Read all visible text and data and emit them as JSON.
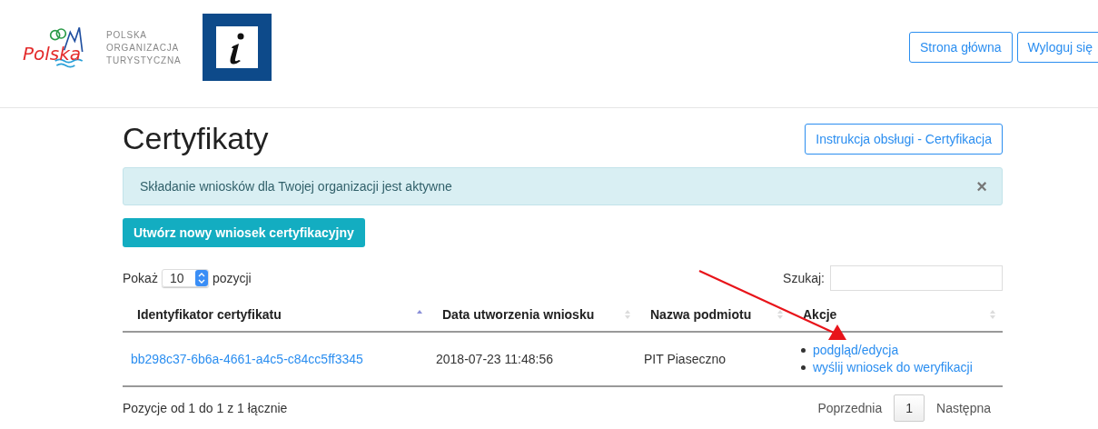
{
  "header": {
    "logo_text": "Polska",
    "org_lines": [
      "POLSKA",
      "ORGANIZACJA",
      "TURYSTYCZNA"
    ],
    "buttons": [
      "Strona główna",
      "Wyloguj się"
    ]
  },
  "page": {
    "title": "Certyfikaty",
    "manual_button": "Instrukcja obsługi - Certyfikacja"
  },
  "alert": {
    "text": "Składanie wniosków dla Twojej organizacji jest aktywne",
    "close": "×"
  },
  "create_button": "Utwórz nowy wniosek certyfikacyjny",
  "length": {
    "label_before": "Pokaż",
    "value": "10",
    "label_after": "pozycji"
  },
  "search": {
    "label": "Szukaj:"
  },
  "table": {
    "columns": [
      {
        "label": "Identyfikator certyfikatu",
        "sorted": true
      },
      {
        "label": "Data utworzenia wniosku",
        "sorted": false
      },
      {
        "label": "Nazwa podmiotu",
        "sorted": false
      },
      {
        "label": "Akcje",
        "sorted": false
      }
    ],
    "rows": [
      {
        "id": "bb298c37-6b6a-4661-a4c5-c84cc5ff3345",
        "date": "2018-07-23 11:48:56",
        "entity": "PIT Piaseczno",
        "actions": [
          "podgląd/edycja",
          "wyślij wniosek do weryfikacji"
        ]
      }
    ]
  },
  "info": "Pozycje od 1 do 1 z 1 łącznie",
  "pagination": [
    {
      "label": "Poprzednia",
      "selected": false
    },
    {
      "label": "1",
      "selected": true
    },
    {
      "label": "Następna",
      "selected": false
    }
  ]
}
